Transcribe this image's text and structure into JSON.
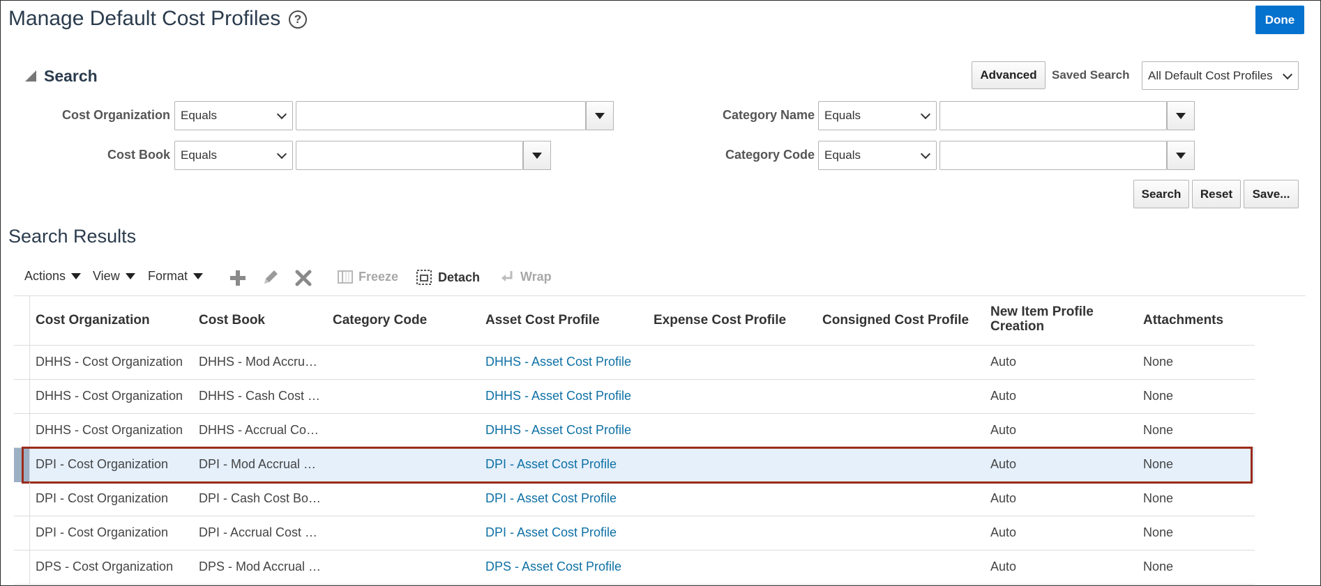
{
  "page": {
    "title": "Manage Default Cost Profiles",
    "help_icon": "?",
    "done_label": "Done"
  },
  "search": {
    "heading": "Search",
    "advanced_label": "Advanced",
    "saved_search_label": "Saved Search",
    "saved_search_value": "All Default Cost Profiles",
    "fields": {
      "cost_org": {
        "label": "Cost Organization",
        "operator": "Equals",
        "value": ""
      },
      "cost_book": {
        "label": "Cost Book",
        "operator": "Equals",
        "value": ""
      },
      "category_name": {
        "label": "Category Name",
        "operator": "Equals",
        "value": ""
      },
      "category_code": {
        "label": "Category Code",
        "operator": "Equals",
        "value": ""
      }
    },
    "search_label": "Search",
    "reset_label": "Reset",
    "save_label": "Save..."
  },
  "results": {
    "title": "Search Results",
    "toolbar": {
      "actions": "Actions",
      "view": "View",
      "format": "Format",
      "freeze": "Freeze",
      "detach": "Detach",
      "wrap": "Wrap",
      "icons": [
        "add-icon",
        "edit-icon",
        "delete-icon",
        "freeze-icon",
        "detach-icon",
        "wrap-icon"
      ]
    },
    "columns": [
      "Cost Organization",
      "Cost Book",
      "Category Code",
      "Asset Cost Profile",
      "Expense Cost Profile",
      "Consigned Cost Profile",
      "New Item Profile Creation",
      "Attachments"
    ],
    "rows": [
      {
        "cost_org": "DHHS - Cost Organization",
        "cost_book": "DHHS - Mod Accru…",
        "category_code": "",
        "asset_profile": "DHHS - Asset Cost Profile",
        "expense_profile": "",
        "consigned_profile": "",
        "new_item": "Auto",
        "attachments": "None"
      },
      {
        "cost_org": "DHHS - Cost Organization",
        "cost_book": "DHHS - Cash Cost …",
        "category_code": "",
        "asset_profile": "DHHS - Asset Cost Profile",
        "expense_profile": "",
        "consigned_profile": "",
        "new_item": "Auto",
        "attachments": "None"
      },
      {
        "cost_org": "DHHS - Cost Organization",
        "cost_book": "DHHS - Accrual Co…",
        "category_code": "",
        "asset_profile": "DHHS - Asset Cost Profile",
        "expense_profile": "",
        "consigned_profile": "",
        "new_item": "Auto",
        "attachments": "None"
      },
      {
        "cost_org": "DPI - Cost Organization",
        "cost_book": "DPI - Mod Accrual …",
        "category_code": "",
        "asset_profile": "DPI - Asset Cost Profile",
        "expense_profile": "",
        "consigned_profile": "",
        "new_item": "Auto",
        "attachments": "None"
      },
      {
        "cost_org": "DPI - Cost Organization",
        "cost_book": "DPI - Cash Cost Bo…",
        "category_code": "",
        "asset_profile": "DPI - Asset Cost Profile",
        "expense_profile": "",
        "consigned_profile": "",
        "new_item": "Auto",
        "attachments": "None"
      },
      {
        "cost_org": "DPI - Cost Organization",
        "cost_book": "DPI - Accrual Cost …",
        "category_code": "",
        "asset_profile": "DPI - Asset Cost Profile",
        "expense_profile": "",
        "consigned_profile": "",
        "new_item": "Auto",
        "attachments": "None"
      },
      {
        "cost_org": "DPS - Cost Organization",
        "cost_book": "DPS - Mod Accrual …",
        "category_code": "",
        "asset_profile": "DPS - Asset Cost Profile",
        "expense_profile": "",
        "consigned_profile": "",
        "new_item": "Auto",
        "attachments": "None"
      }
    ],
    "selected_row_index": 3
  },
  "colors": {
    "accent": "#0572ce",
    "link": "#0e70a5",
    "selection_bg": "#e5f0fb",
    "highlight_border": "#9b2a1a"
  }
}
